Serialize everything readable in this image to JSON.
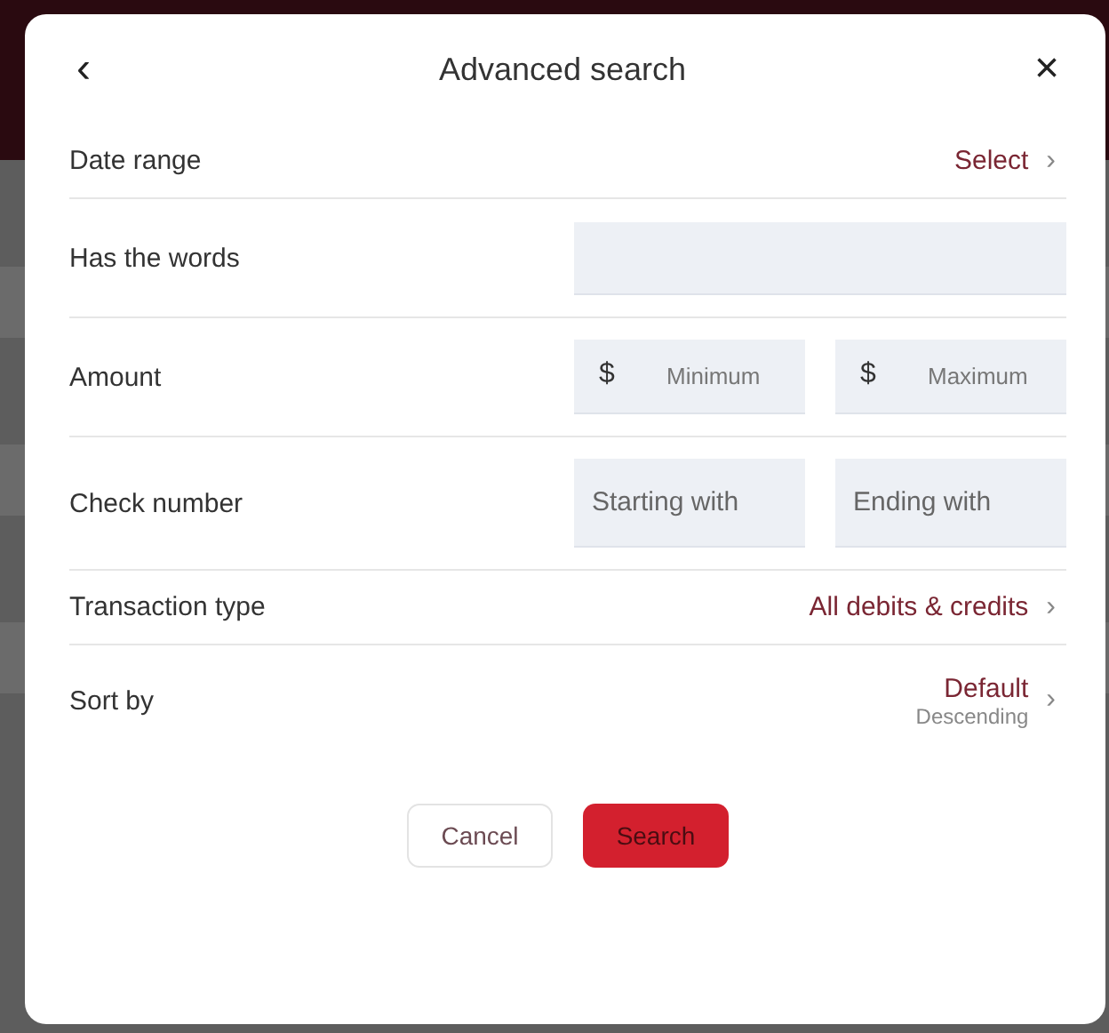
{
  "dialog": {
    "title": "Advanced search",
    "back": "‹",
    "close": "×"
  },
  "rows": [
    {
      "kind": "select",
      "label": "Date range",
      "value": "Select",
      "chevron": "›"
    },
    {
      "kind": "text",
      "label": "Has the words"
    },
    {
      "kind": "amount",
      "label": "Amount",
      "fields": [
        {
          "prefix": "$",
          "placeholder": "Minimum"
        },
        {
          "prefix": "$",
          "placeholder": "Maximum"
        }
      ]
    },
    {
      "kind": "range",
      "label": "Check number",
      "fields": [
        {
          "placeholder": "Starting with"
        },
        {
          "placeholder": "Ending with"
        }
      ]
    },
    {
      "kind": "select",
      "label": "Transaction type",
      "value": "All debits & credits",
      "chevron": "›"
    },
    {
      "kind": "select",
      "label": "Sort by",
      "value": "Default",
      "subvalue": "Descending",
      "chevron": "›"
    }
  ],
  "buttons": [
    {
      "kind": "secondary",
      "label": "Cancel"
    },
    {
      "kind": "primary",
      "label": "Search"
    }
  ]
}
